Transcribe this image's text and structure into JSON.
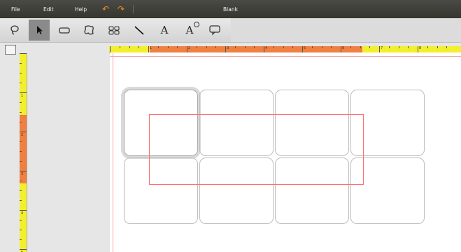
{
  "menubar": {
    "file": "File",
    "edit": "Edit",
    "help": "Help",
    "undo_icon": "undo-icon",
    "redo_icon": "redo-icon",
    "title": "Blank"
  },
  "toolbar": {
    "tools": [
      {
        "name": "lasso-tool",
        "icon": "lasso-icon"
      },
      {
        "name": "select-tool",
        "icon": "arrow-pointer-icon",
        "active": true
      },
      {
        "name": "rectangle-tool",
        "icon": "rounded-rectangle-icon"
      },
      {
        "name": "freeform-tool",
        "icon": "blob-shape-icon"
      },
      {
        "name": "grid-tool",
        "icon": "grid-shapes-icon"
      },
      {
        "name": "line-tool",
        "icon": "line-icon"
      },
      {
        "name": "text-tool",
        "icon": "text-a-icon",
        "label": "A"
      },
      {
        "name": "word-art-tool",
        "icon": "text-a-shape-icon",
        "label": "A"
      },
      {
        "name": "callout-tool",
        "icon": "speech-bubble-icon"
      }
    ]
  },
  "rulers": {
    "horizontal_numbers": [
      "1",
      "2",
      "3",
      "4",
      "5",
      "6",
      "7",
      "8"
    ],
    "vertical_numbers": [
      "1",
      "2",
      "3",
      "4",
      "5"
    ]
  },
  "accent": "#f08040",
  "ruler_color": "#f4ef2d",
  "guide_color": "#ff6f6f"
}
